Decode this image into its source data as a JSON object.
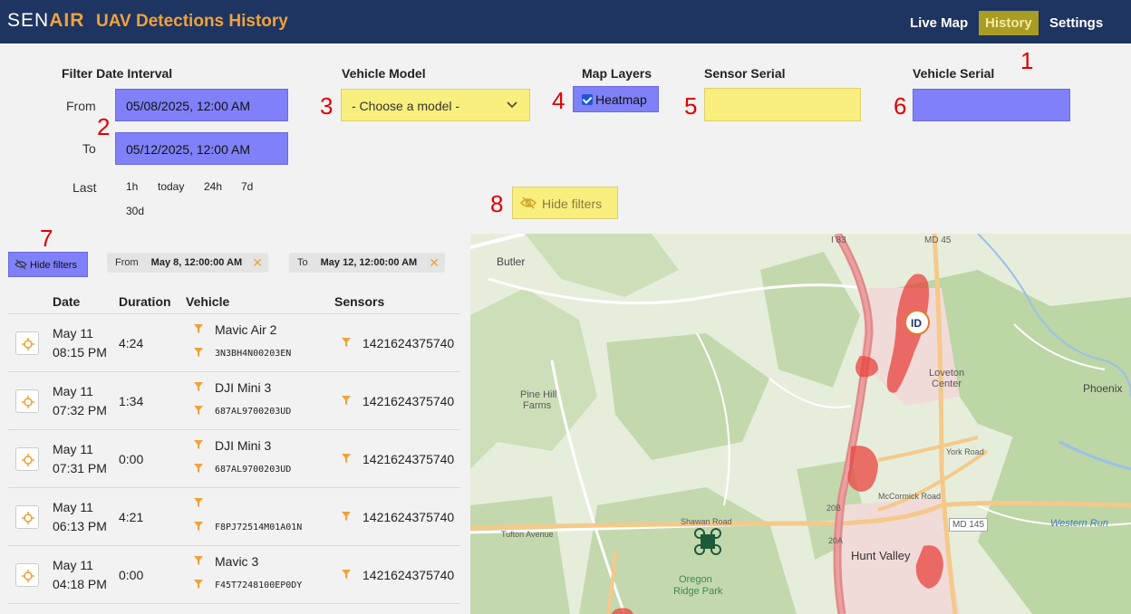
{
  "header": {
    "logo_main": "SEN",
    "logo_accent": "AIR",
    "title": "UAV Detections History",
    "nav": {
      "live_map": "Live Map",
      "history": "History",
      "settings": "Settings"
    }
  },
  "callouts": [
    "1",
    "2",
    "3",
    "4",
    "5",
    "6",
    "7",
    "8"
  ],
  "filters": {
    "date_interval_label": "Filter Date Interval",
    "from_label": "From",
    "from_value": "05/08/2025, 12:00 AM",
    "to_label": "To",
    "to_value": "05/12/2025, 12:00 AM",
    "last_label": "Last",
    "quick_ranges": [
      "1h",
      "today",
      "24h",
      "7d",
      "30d"
    ],
    "vehicle_model_label": "Vehicle Model",
    "vehicle_model_selected": "- Choose a model -",
    "map_layers_label": "Map Layers",
    "heatmap_label": "Heatmap",
    "heatmap_checked": true,
    "sensor_serial_label": "Sensor Serial",
    "sensor_serial_value": "",
    "vehicle_serial_label": "Vehicle Serial",
    "vehicle_serial_value": "",
    "hide_filters_label": "Hide filters"
  },
  "list": {
    "hide_filters_label": "Hide filters",
    "chips": [
      {
        "label": "From",
        "value": "May 8, 12:00:00 AM"
      },
      {
        "label": "To",
        "value": "May 12, 12:00:00 AM"
      }
    ],
    "columns": [
      "Date",
      "Duration",
      "Vehicle",
      "Sensors"
    ],
    "rows": [
      {
        "date": "May 11",
        "time": "08:15 PM",
        "duration": "4:24",
        "model": "Mavic Air 2",
        "serial": "3N3BH4N00203EN",
        "sensor": "1421624375740"
      },
      {
        "date": "May 11",
        "time": "07:32 PM",
        "duration": "1:34",
        "model": "DJI Mini 3",
        "serial": "687AL9700203UD",
        "sensor": "1421624375740"
      },
      {
        "date": "May 11",
        "time": "07:31 PM",
        "duration": "0:00",
        "model": "DJI Mini 3",
        "serial": "687AL9700203UD",
        "sensor": "1421624375740"
      },
      {
        "date": "May 11",
        "time": "06:13 PM",
        "duration": "4:21",
        "model": "",
        "serial": "F8PJ72514M01A01N",
        "sensor": "1421624375740"
      },
      {
        "date": "May 11",
        "time": "04:18 PM",
        "duration": "0:00",
        "model": "Mavic 3",
        "serial": "F45T7248100EP0DY",
        "sensor": "1421624375740"
      }
    ]
  },
  "map": {
    "labels": {
      "butler": "Butler",
      "i83": "I 83",
      "md45": "MD 45",
      "pine_hill": "Pine Hill",
      "farms": "Farms",
      "loveton": "Loveton",
      "center": "Center",
      "phoenix": "Phoenix",
      "shawan": "Shawan Road",
      "tufton": "Tufton Avenue",
      "mccormick": "McCormick Road",
      "york": "York Road",
      "md145": "MD 145",
      "hunt_valley": "Hunt Valley",
      "oregon1": "Oregon",
      "oregon2": "Ridge Park",
      "western_run": "Western Run",
      "exit20b": "20B",
      "exit20a": "20A"
    },
    "colors": {
      "heat": "#e8433f",
      "road_major": "#e28a8a",
      "road_minor": "#f4c98a",
      "background": "#e6eedb",
      "forest": "#b9d4a2"
    }
  }
}
